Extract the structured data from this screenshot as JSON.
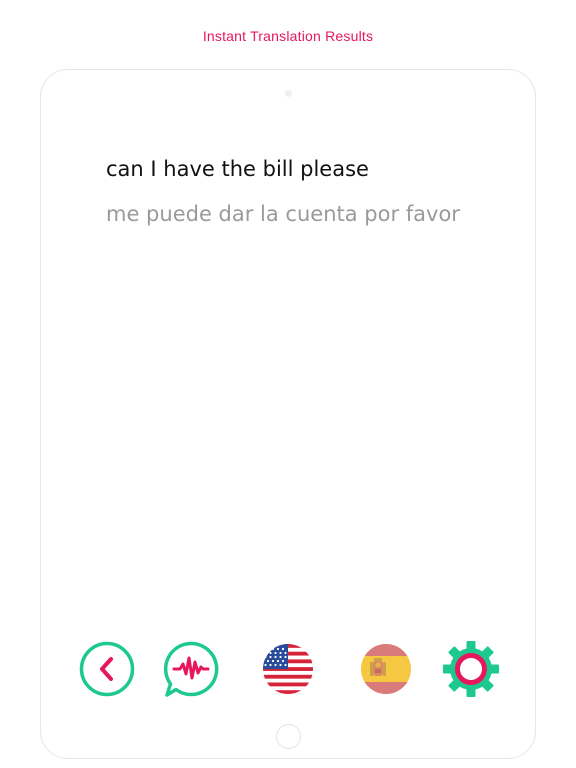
{
  "header": {
    "caption": "Instant Translation Results",
    "accent_color": "#e8175d"
  },
  "translation": {
    "source_text": "can I have the bill please",
    "translated_text": "me puede dar la cuenta por favor"
  },
  "toolbar": {
    "back_icon": "chevron-left-icon",
    "voice_icon": "speech-waveform-icon",
    "source_language_icon": "us-flag-icon",
    "target_language_icon": "spain-flag-icon",
    "settings_icon": "gear-icon",
    "back_color": "#1ec98f",
    "settings_color": "#1ec98f"
  }
}
